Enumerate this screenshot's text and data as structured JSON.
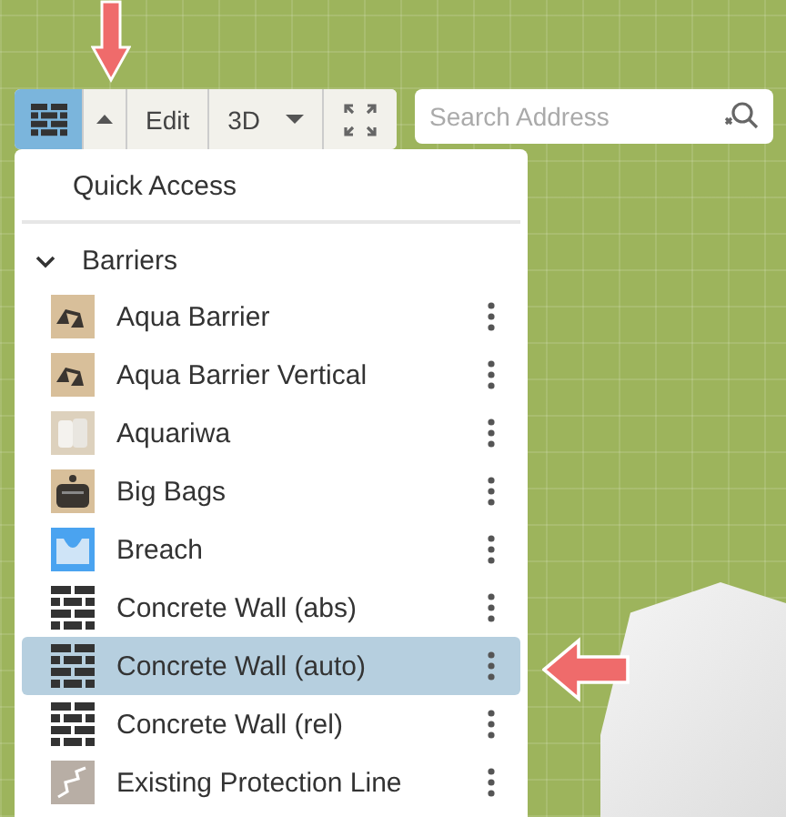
{
  "toolbar": {
    "buttons": [
      {
        "kind": "wall",
        "selected": true
      },
      {
        "kind": "caret-up",
        "selected": false
      },
      {
        "kind": "text",
        "label": "Edit",
        "selected": false
      },
      {
        "kind": "dropdown",
        "label": "3D",
        "selected": false
      },
      {
        "kind": "expand",
        "selected": false
      }
    ],
    "search": {
      "placeholder": "Search Address"
    }
  },
  "menu": {
    "quick_access": "Quick Access",
    "group": {
      "label": "Barriers",
      "expanded": true,
      "items": [
        {
          "label": "Aqua Barrier",
          "kind": "aqua",
          "selected": false
        },
        {
          "label": "Aqua Barrier Vertical",
          "kind": "aqua",
          "selected": false
        },
        {
          "label": "Aquariwa",
          "kind": "tube",
          "selected": false
        },
        {
          "label": "Big Bags",
          "kind": "bag",
          "selected": false
        },
        {
          "label": "Breach",
          "kind": "breach",
          "selected": false
        },
        {
          "label": "Concrete Wall (abs)",
          "kind": "wall",
          "selected": false
        },
        {
          "label": "Concrete Wall (auto)",
          "kind": "wall",
          "selected": true
        },
        {
          "label": "Concrete Wall (rel)",
          "kind": "wall",
          "selected": false
        },
        {
          "label": "Existing Protection Line",
          "kind": "line",
          "selected": false
        }
      ]
    }
  }
}
